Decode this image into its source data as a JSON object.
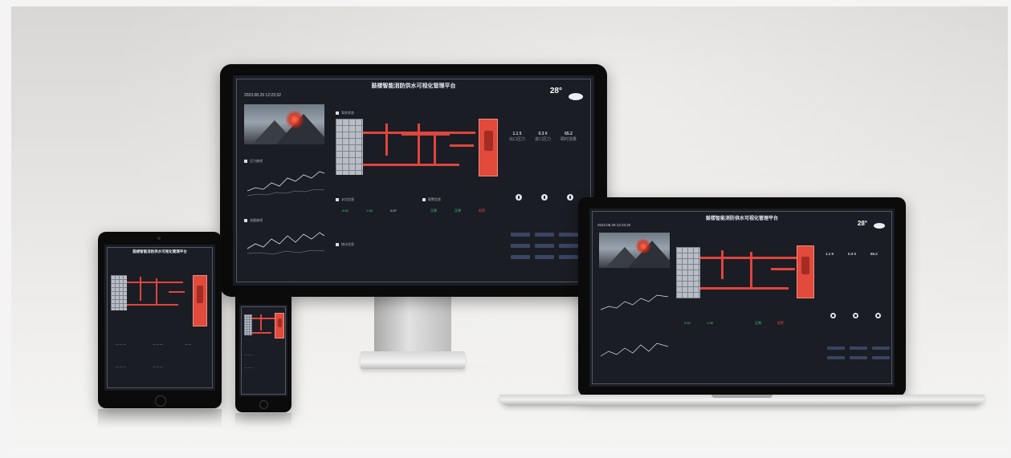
{
  "dashboard": {
    "title": "鼓楼智能消防供水可视化管理平台",
    "date": "2023.08.29 12:23:32",
    "temp": "28°"
  },
  "panels": {
    "weather_cam": "",
    "pressure_curve": "压力曲线",
    "flow_curve": "流量曲线",
    "pump_status": "泵房状态",
    "water_level": "水位信息",
    "alarm": "报警信息",
    "statistics": "统计信息"
  },
  "metrics": [
    {
      "value": "1.1 5",
      "label": "出口压力"
    },
    {
      "value": "0.3 0",
      "label": "进口压力"
    },
    {
      "value": "65.2",
      "label": "瞬时流量"
    }
  ],
  "colors": {
    "accent": "#e0453e",
    "screen_bg": "#1b1d24",
    "bezel": "#0b0b0c",
    "button": "#3a4563",
    "text_green": "#3fd08a"
  },
  "icons": [
    "cloud-icon",
    "gauge-icon",
    "info-icon",
    "alert-icon"
  ]
}
